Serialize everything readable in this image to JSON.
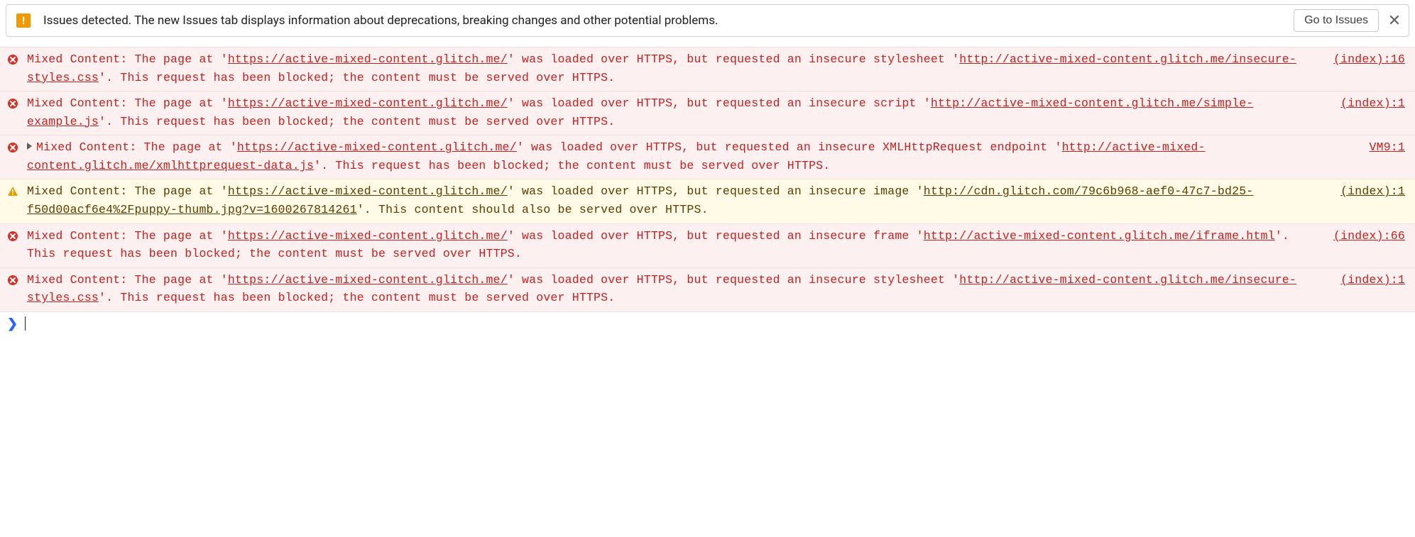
{
  "issuesBar": {
    "text": "Issues detected. The new Issues tab displays information about deprecations, breaking changes and other potential problems.",
    "button": "Go to Issues"
  },
  "rows": [
    {
      "level": "error",
      "expandable": false,
      "pre": "Mixed Content: The page at '",
      "url1": "https://active-mixed-content.glitch.me/",
      "mid": "' was loaded over HTTPS, but requested an insecure stylesheet '",
      "url2": "http://active-mixed-content.glitch.me/insecure-styles.css",
      "post": "'. This request has been blocked; the content must be served over HTTPS.",
      "source": "(index):16"
    },
    {
      "level": "error",
      "expandable": false,
      "pre": "Mixed Content: The page at '",
      "url1": "https://active-mixed-content.glitch.me/",
      "mid": "' was loaded over HTTPS, but requested an insecure script '",
      "url2": "http://active-mixed-content.glitch.me/simple-example.js",
      "post": "'. This request has been blocked; the content must be served over HTTPS.",
      "source": "(index):1"
    },
    {
      "level": "error",
      "expandable": true,
      "pre": "Mixed Content: The page at '",
      "url1": "https://active-mixed-content.glitch.me/",
      "mid": "' was loaded over HTTPS, but requested an insecure XMLHttpRequest endpoint '",
      "url2": "http://active-mixed-content.glitch.me/xmlhttprequest-data.js",
      "post": "'. This request has been blocked; the content must be served over HTTPS.",
      "source": "VM9:1"
    },
    {
      "level": "warning",
      "expandable": false,
      "pre": "Mixed Content: The page at '",
      "url1": "https://active-mixed-content.glitch.me/",
      "mid": "' was loaded over HTTPS, but requested an insecure image '",
      "url2": "http://cdn.glitch.com/79c6b968-aef0-47c7-bd25-f50d00acf6e4%2Fpuppy-thumb.jpg?v=1600267814261",
      "post": "'. This content should also be served over HTTPS.",
      "source": "(index):1"
    },
    {
      "level": "error",
      "expandable": false,
      "pre": "Mixed Content: The page at '",
      "url1": "https://active-mixed-content.glitch.me/",
      "mid": "' was loaded over HTTPS, but requested an insecure frame '",
      "url2": "http://active-mixed-content.glitch.me/iframe.html",
      "post": "'. This request has been blocked; the content must be served over HTTPS.",
      "source": "(index):66"
    },
    {
      "level": "error",
      "expandable": false,
      "pre": "Mixed Content: The page at '",
      "url1": "https://active-mixed-content.glitch.me/",
      "mid": "' was loaded over HTTPS, but requested an insecure stylesheet '",
      "url2": "http://active-mixed-content.glitch.me/insecure-styles.css",
      "post": "'. This request has been blocked; the content must be served over HTTPS.",
      "source": "(index):1"
    }
  ]
}
